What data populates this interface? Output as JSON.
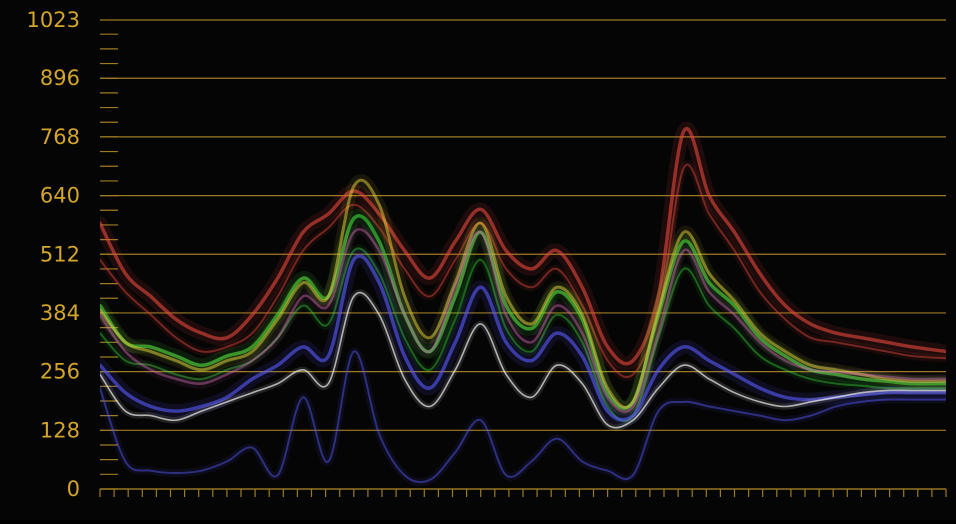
{
  "chart_data": {
    "type": "line",
    "ylim": [
      0,
      1023
    ],
    "y_ticks": [
      {
        "value": 1023,
        "label": "1023"
      },
      {
        "value": 896,
        "label": "896"
      },
      {
        "value": 768,
        "label": "768"
      },
      {
        "value": 640,
        "label": "640"
      },
      {
        "value": 512,
        "label": "512"
      },
      {
        "value": 384,
        "label": "384"
      },
      {
        "value": 256,
        "label": "256"
      },
      {
        "value": 128,
        "label": "128"
      },
      {
        "value": 0,
        "label": "0"
      }
    ],
    "minor_tick_step": 32,
    "x_ticks_count": 60,
    "grid": true,
    "colors": {
      "grid": "#9c7b22",
      "label": "#d4a52c",
      "background": "#050505",
      "red": "#e8483c",
      "green": "#3cdc3c",
      "blue": "#5a5aff",
      "white": "#f0f0f0",
      "yellow": "#e8d23c",
      "pink": "#e070c0"
    },
    "x": [
      0.0,
      0.03,
      0.06,
      0.09,
      0.12,
      0.15,
      0.18,
      0.21,
      0.24,
      0.27,
      0.3,
      0.33,
      0.36,
      0.39,
      0.42,
      0.45,
      0.48,
      0.51,
      0.54,
      0.57,
      0.6,
      0.63,
      0.66,
      0.69,
      0.72,
      0.75,
      0.78,
      0.81,
      0.84,
      0.87,
      0.9,
      0.93,
      0.96,
      1.0
    ],
    "series": [
      {
        "color": "red",
        "width": 3.5,
        "opacity": 0.6,
        "values": [
          580,
          470,
          420,
          370,
          340,
          330,
          380,
          460,
          560,
          600,
          650,
          600,
          520,
          460,
          540,
          610,
          520,
          480,
          520,
          440,
          310,
          280,
          420,
          780,
          640,
          560,
          470,
          400,
          360,
          340,
          330,
          320,
          310,
          300
        ]
      },
      {
        "color": "red",
        "width": 2,
        "opacity": 0.45,
        "values": [
          500,
          430,
          380,
          330,
          300,
          310,
          340,
          420,
          520,
          570,
          620,
          570,
          480,
          420,
          500,
          580,
          480,
          440,
          480,
          400,
          280,
          250,
          380,
          700,
          600,
          520,
          430,
          370,
          330,
          320,
          310,
          300,
          290,
          285
        ]
      },
      {
        "color": "green",
        "width": 3.5,
        "opacity": 0.6,
        "values": [
          400,
          320,
          310,
          290,
          270,
          290,
          310,
          380,
          460,
          420,
          590,
          540,
          380,
          300,
          420,
          560,
          400,
          350,
          430,
          370,
          210,
          190,
          380,
          540,
          450,
          400,
          330,
          290,
          260,
          250,
          240,
          235,
          230,
          230
        ]
      },
      {
        "color": "green",
        "width": 2,
        "opacity": 0.4,
        "values": [
          340,
          280,
          270,
          250,
          240,
          260,
          280,
          330,
          400,
          360,
          520,
          470,
          330,
          260,
          370,
          500,
          350,
          300,
          380,
          320,
          180,
          160,
          330,
          480,
          400,
          350,
          290,
          260,
          240,
          230,
          225,
          220,
          220,
          220
        ]
      },
      {
        "color": "blue",
        "width": 3.5,
        "opacity": 0.6,
        "values": [
          270,
          210,
          180,
          170,
          180,
          200,
          240,
          270,
          310,
          290,
          500,
          450,
          290,
          220,
          320,
          440,
          320,
          280,
          340,
          290,
          170,
          160,
          260,
          310,
          280,
          250,
          220,
          200,
          195,
          200,
          205,
          210,
          210,
          210
        ]
      },
      {
        "color": "blue",
        "width": 2,
        "opacity": 0.45,
        "values": [
          220,
          60,
          40,
          35,
          40,
          60,
          90,
          30,
          200,
          60,
          300,
          120,
          30,
          20,
          80,
          150,
          30,
          60,
          110,
          60,
          40,
          30,
          170,
          190,
          180,
          170,
          160,
          150,
          160,
          180,
          190,
          195,
          195,
          195
        ]
      },
      {
        "color": "white",
        "width": 1.6,
        "opacity": 0.7,
        "values": [
          250,
          170,
          160,
          150,
          170,
          190,
          210,
          230,
          260,
          230,
          420,
          380,
          240,
          180,
          260,
          360,
          250,
          200,
          270,
          230,
          140,
          150,
          220,
          270,
          240,
          210,
          190,
          180,
          190,
          200,
          210,
          215,
          215,
          215
        ]
      },
      {
        "color": "yellow",
        "width": 3,
        "opacity": 0.5,
        "values": [
          390,
          320,
          300,
          280,
          260,
          280,
          300,
          370,
          450,
          420,
          660,
          620,
          420,
          330,
          450,
          580,
          420,
          360,
          440,
          380,
          220,
          190,
          390,
          560,
          470,
          410,
          340,
          300,
          270,
          260,
          250,
          240,
          235,
          235
        ]
      },
      {
        "color": "pink",
        "width": 2.5,
        "opacity": 0.4,
        "values": [
          380,
          300,
          260,
          240,
          230,
          250,
          280,
          330,
          420,
          400,
          560,
          520,
          380,
          300,
          440,
          560,
          380,
          320,
          400,
          340,
          200,
          180,
          340,
          520,
          430,
          380,
          320,
          280,
          260,
          255,
          250,
          245,
          240,
          240
        ]
      }
    ]
  }
}
